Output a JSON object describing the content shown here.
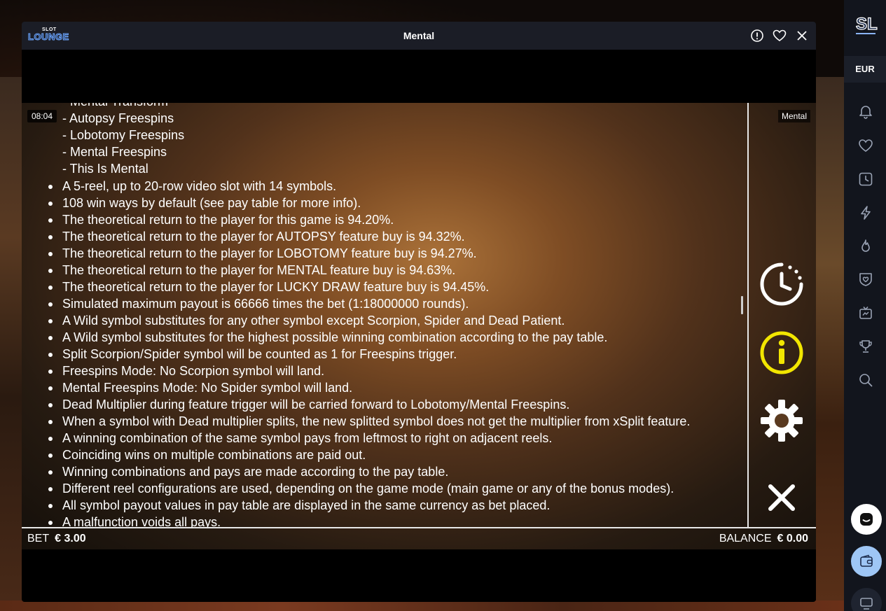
{
  "window": {
    "title": "Mental",
    "logo_top": "SLOT",
    "logo_bottom": "LOUNGE"
  },
  "game": {
    "clock": "08:04",
    "label": "Mental",
    "sub_lines": [
      "- Mental Transform",
      "- Autopsy Freespins",
      "- Lobotomy Freespins",
      "- Mental Freespins",
      "- This Is Mental"
    ],
    "bullets": [
      "A 5-reel, up to 20-row video slot with 14 symbols.",
      "108 win ways by default (see pay table for more info).",
      "The theoretical return to the player for this game is 94.20%.",
      "The theoretical return to the player for AUTOPSY feature buy is 94.32%.",
      "The theoretical return to the player for LOBOTOMY feature buy is 94.27%.",
      "The theoretical return to the player for MENTAL feature buy is 94.63%.",
      "The theoretical return to the player for LUCKY DRAW feature buy is 94.45%.",
      "Simulated maximum payout is 66666 times the bet (1:18000000 rounds).",
      "A Wild symbol substitutes for any other symbol except Scorpion, Spider and Dead Patient.",
      "A Wild symbol substitutes for the highest possible winning combination according to the pay table.",
      "Split Scorpion/Spider symbol will be counted as 1 for Freespins trigger.",
      "Freespins Mode: No Scorpion symbol will land.",
      "Mental Freespins Mode: No Spider symbol will land.",
      "Dead Multiplier during feature trigger will be carried forward to Lobotomy/Mental Freespins.",
      "When a symbol with Dead multiplier splits, the new splitted symbol does not get the multiplier from xSplit feature.",
      "A winning combination of the same symbol pays from leftmost to right on adjacent reels.",
      "Coinciding wins on multiple combinations are paid out.",
      "Winning combinations and pays are made according to the pay table.",
      "Different reel configurations are used, depending on the game mode (main game or any of the bonus modes).",
      "All symbol payout values in pay table are displayed in the same currency as bet placed.",
      "A malfunction voids all pays."
    ],
    "bet_label": "BET",
    "bet_value": "€ 3.00",
    "balance_label": "BALANCE",
    "balance_value": "€ 0.00"
  },
  "sidebar": {
    "logo": "SL",
    "currency": "EUR"
  },
  "colors": {
    "accent_yellow": "#f2e600",
    "sidebar_bg": "#12151d",
    "titlebar_bg": "#1b1d26"
  }
}
